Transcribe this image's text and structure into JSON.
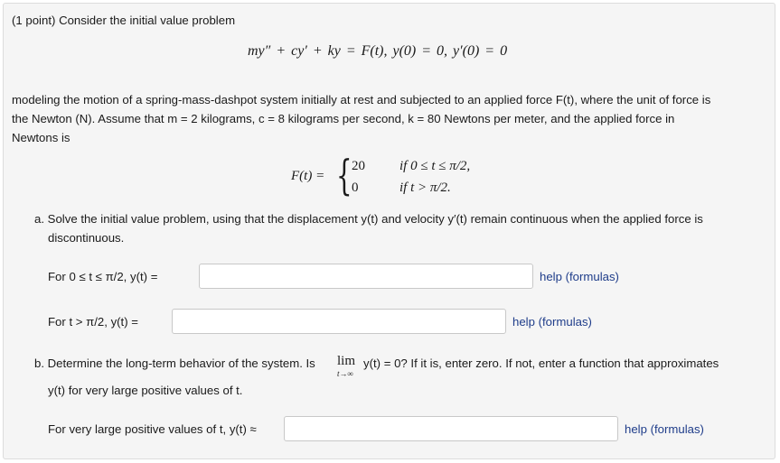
{
  "problem": {
    "points_label": "(1 point)",
    "intro": "Consider the initial value problem",
    "equation": "my″ + cy′ + ky = F(t),   y(0) = 0,   y′(0) = 0",
    "line1": "modeling the motion of a spring-mass-dashpot system initially at rest and subjected to an applied force F(t), where the unit of force is",
    "line2": "the Newton (N). Assume that m = 2 kilograms, c = 8 kilograms per second, k = 80 Newtons per meter, and the applied force in",
    "line3": "Newtons is",
    "piecewise": {
      "lhs": "F(t) =",
      "case1_value": "20",
      "case1_condition": "if 0 ≤ t ≤ π/2,",
      "case2_value": "0",
      "case2_condition": "if t > π/2."
    }
  },
  "part_a": {
    "text1": "a. Solve the initial value problem, using that the displacement y(t) and velocity y′(t) remain continuous when the applied force is",
    "text2": "discontinuous.",
    "answer1_label": "For 0 ≤ t ≤ π/2,  y(t) =",
    "answer1_value": "",
    "answer2_label": "For t > π/2,  y(t) =",
    "answer2_value": ""
  },
  "part_b": {
    "text1_before": "b. Determine the long-term behavior of the system. Is",
    "lim": "lim",
    "lim_sub": "t→∞",
    "text1_after": "y(t) = 0? If it is, enter zero. If not, enter a function that approximates",
    "text2": "y(t) for very large positive values of t.",
    "answer_label": "For very large positive values of t, y(t) ≈",
    "answer_value": ""
  },
  "help_link": "help (formulas)"
}
